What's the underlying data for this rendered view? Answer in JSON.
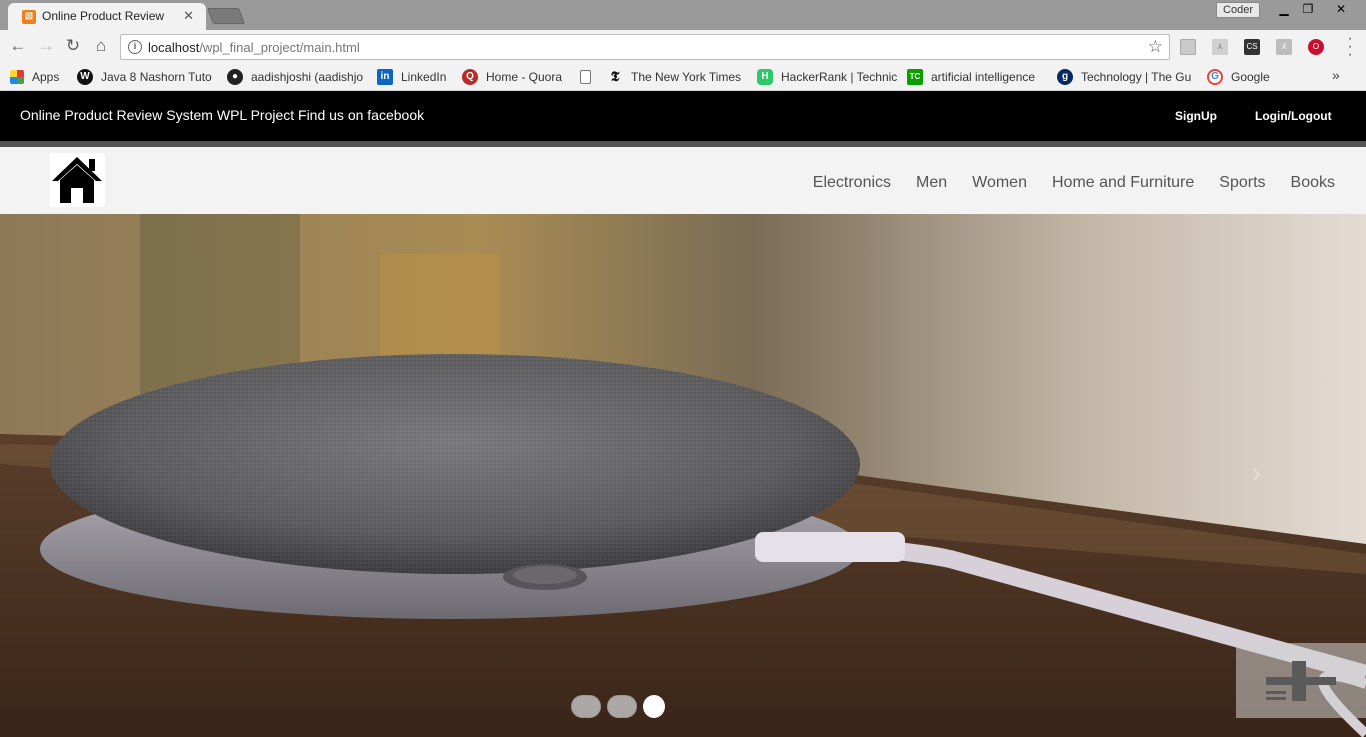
{
  "browser": {
    "tab_title": "Online Product Review",
    "profile_name": "Coder",
    "url_host": "localhost",
    "url_path": "/wpl_final_project/main.html",
    "bookmarks": [
      {
        "label": "Apps"
      },
      {
        "label": "Java 8 Nashorn Tuto"
      },
      {
        "label": "aadishjoshi (aadishjo"
      },
      {
        "label": "LinkedIn"
      },
      {
        "label": "Home - Quora"
      },
      {
        "label": ""
      },
      {
        "label": "The New York Times"
      },
      {
        "label": "HackerRank | Technic"
      },
      {
        "label": "artificial intelligence"
      },
      {
        "label": "Technology | The Gu"
      },
      {
        "label": "Google"
      }
    ],
    "ext_cs": "CS"
  },
  "page": {
    "tagline": "Online Product Review System WPL Project Find us on facebook",
    "signup": "SignUp",
    "login": "Login/Logout",
    "nav": [
      "Electronics",
      "Men",
      "Women",
      "Home and Furniture",
      "Sports",
      "Books"
    ]
  },
  "carousel": {
    "slide_count": 3,
    "active_index": 2
  }
}
